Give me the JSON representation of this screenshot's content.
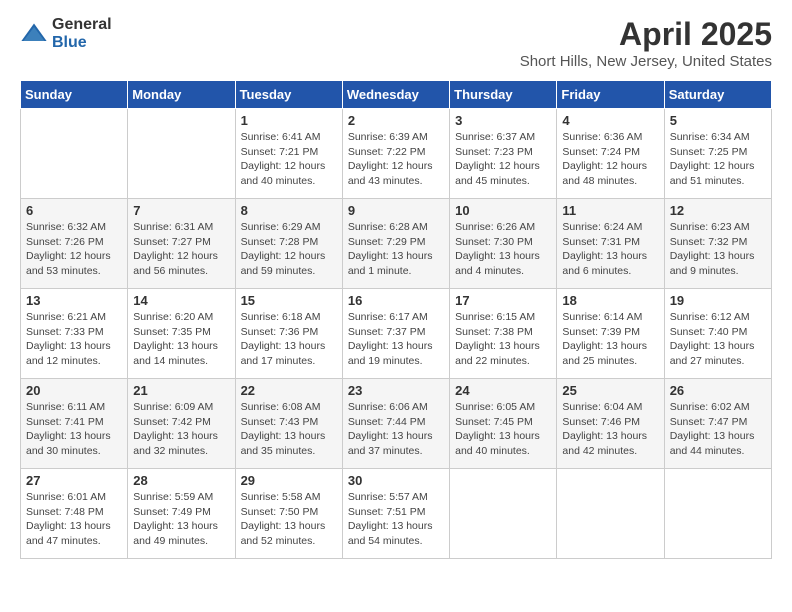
{
  "header": {
    "logo_general": "General",
    "logo_blue": "Blue",
    "title": "April 2025",
    "subtitle": "Short Hills, New Jersey, United States"
  },
  "days_of_week": [
    "Sunday",
    "Monday",
    "Tuesday",
    "Wednesday",
    "Thursday",
    "Friday",
    "Saturday"
  ],
  "weeks": [
    [
      {
        "day": "",
        "info": ""
      },
      {
        "day": "",
        "info": ""
      },
      {
        "day": "1",
        "info": "Sunrise: 6:41 AM\nSunset: 7:21 PM\nDaylight: 12 hours and 40 minutes."
      },
      {
        "day": "2",
        "info": "Sunrise: 6:39 AM\nSunset: 7:22 PM\nDaylight: 12 hours and 43 minutes."
      },
      {
        "day": "3",
        "info": "Sunrise: 6:37 AM\nSunset: 7:23 PM\nDaylight: 12 hours and 45 minutes."
      },
      {
        "day": "4",
        "info": "Sunrise: 6:36 AM\nSunset: 7:24 PM\nDaylight: 12 hours and 48 minutes."
      },
      {
        "day": "5",
        "info": "Sunrise: 6:34 AM\nSunset: 7:25 PM\nDaylight: 12 hours and 51 minutes."
      }
    ],
    [
      {
        "day": "6",
        "info": "Sunrise: 6:32 AM\nSunset: 7:26 PM\nDaylight: 12 hours and 53 minutes."
      },
      {
        "day": "7",
        "info": "Sunrise: 6:31 AM\nSunset: 7:27 PM\nDaylight: 12 hours and 56 minutes."
      },
      {
        "day": "8",
        "info": "Sunrise: 6:29 AM\nSunset: 7:28 PM\nDaylight: 12 hours and 59 minutes."
      },
      {
        "day": "9",
        "info": "Sunrise: 6:28 AM\nSunset: 7:29 PM\nDaylight: 13 hours and 1 minute."
      },
      {
        "day": "10",
        "info": "Sunrise: 6:26 AM\nSunset: 7:30 PM\nDaylight: 13 hours and 4 minutes."
      },
      {
        "day": "11",
        "info": "Sunrise: 6:24 AM\nSunset: 7:31 PM\nDaylight: 13 hours and 6 minutes."
      },
      {
        "day": "12",
        "info": "Sunrise: 6:23 AM\nSunset: 7:32 PM\nDaylight: 13 hours and 9 minutes."
      }
    ],
    [
      {
        "day": "13",
        "info": "Sunrise: 6:21 AM\nSunset: 7:33 PM\nDaylight: 13 hours and 12 minutes."
      },
      {
        "day": "14",
        "info": "Sunrise: 6:20 AM\nSunset: 7:35 PM\nDaylight: 13 hours and 14 minutes."
      },
      {
        "day": "15",
        "info": "Sunrise: 6:18 AM\nSunset: 7:36 PM\nDaylight: 13 hours and 17 minutes."
      },
      {
        "day": "16",
        "info": "Sunrise: 6:17 AM\nSunset: 7:37 PM\nDaylight: 13 hours and 19 minutes."
      },
      {
        "day": "17",
        "info": "Sunrise: 6:15 AM\nSunset: 7:38 PM\nDaylight: 13 hours and 22 minutes."
      },
      {
        "day": "18",
        "info": "Sunrise: 6:14 AM\nSunset: 7:39 PM\nDaylight: 13 hours and 25 minutes."
      },
      {
        "day": "19",
        "info": "Sunrise: 6:12 AM\nSunset: 7:40 PM\nDaylight: 13 hours and 27 minutes."
      }
    ],
    [
      {
        "day": "20",
        "info": "Sunrise: 6:11 AM\nSunset: 7:41 PM\nDaylight: 13 hours and 30 minutes."
      },
      {
        "day": "21",
        "info": "Sunrise: 6:09 AM\nSunset: 7:42 PM\nDaylight: 13 hours and 32 minutes."
      },
      {
        "day": "22",
        "info": "Sunrise: 6:08 AM\nSunset: 7:43 PM\nDaylight: 13 hours and 35 minutes."
      },
      {
        "day": "23",
        "info": "Sunrise: 6:06 AM\nSunset: 7:44 PM\nDaylight: 13 hours and 37 minutes."
      },
      {
        "day": "24",
        "info": "Sunrise: 6:05 AM\nSunset: 7:45 PM\nDaylight: 13 hours and 40 minutes."
      },
      {
        "day": "25",
        "info": "Sunrise: 6:04 AM\nSunset: 7:46 PM\nDaylight: 13 hours and 42 minutes."
      },
      {
        "day": "26",
        "info": "Sunrise: 6:02 AM\nSunset: 7:47 PM\nDaylight: 13 hours and 44 minutes."
      }
    ],
    [
      {
        "day": "27",
        "info": "Sunrise: 6:01 AM\nSunset: 7:48 PM\nDaylight: 13 hours and 47 minutes."
      },
      {
        "day": "28",
        "info": "Sunrise: 5:59 AM\nSunset: 7:49 PM\nDaylight: 13 hours and 49 minutes."
      },
      {
        "day": "29",
        "info": "Sunrise: 5:58 AM\nSunset: 7:50 PM\nDaylight: 13 hours and 52 minutes."
      },
      {
        "day": "30",
        "info": "Sunrise: 5:57 AM\nSunset: 7:51 PM\nDaylight: 13 hours and 54 minutes."
      },
      {
        "day": "",
        "info": ""
      },
      {
        "day": "",
        "info": ""
      },
      {
        "day": "",
        "info": ""
      }
    ]
  ]
}
